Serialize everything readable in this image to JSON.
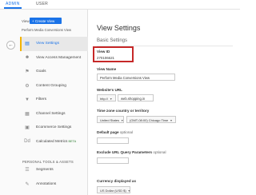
{
  "tabs": {
    "admin": "ADMIN",
    "user": "USER"
  },
  "left": {
    "view_label": "View",
    "create_view": "+ Create View",
    "view_name": "Perform Media Conversions View",
    "back_icon": "arrow-left-icon",
    "nav_items": [
      {
        "label": "View Settings",
        "icon": "document-icon",
        "active": true
      },
      {
        "label": "View Access Management",
        "icon": "users-icon"
      },
      {
        "label": "Goals",
        "icon": "flag-icon"
      },
      {
        "label": "Content Grouping",
        "icon": "grouping-icon"
      },
      {
        "label": "Filters",
        "icon": "filter-icon"
      },
      {
        "label": "Channel Settings",
        "icon": "channel-icon"
      },
      {
        "label": "Ecommerce Settings",
        "icon": "cart-icon"
      },
      {
        "label": "Calculated Metrics",
        "icon": "calculator-icon",
        "badge": "BETA"
      }
    ],
    "section_header": "PERSONAL TOOLS & ASSETS",
    "nav2_items": [
      {
        "label": "Segments",
        "icon": "segments-icon"
      },
      {
        "label": "Annotations",
        "icon": "annotation-icon"
      }
    ]
  },
  "main": {
    "title": "View Settings",
    "subtitle": "Basic Settings",
    "view_id_label": "View ID",
    "view_id_value": "270106621",
    "view_name_label": "View Name",
    "view_name_value": "Perform Media Conversions View",
    "website_url_label": "Website's URL",
    "protocol": "http://",
    "website_url_value": "web.shopping.in",
    "timezone_label": "Time zone country or territory",
    "country": "United States",
    "timezone": "(GMT-08:00) Chicago Time",
    "default_page_label": "Default page",
    "default_page_optional": "optional",
    "exclude_label": "Exclude URL Query Parameters",
    "exclude_optional": "optional",
    "currency_label": "Currency displayed as",
    "currency_value": "US Dollar (USD $)"
  },
  "colors": {
    "accent": "#1a73e8",
    "highlight": "#c62828",
    "active_bar": "#f4b400"
  }
}
